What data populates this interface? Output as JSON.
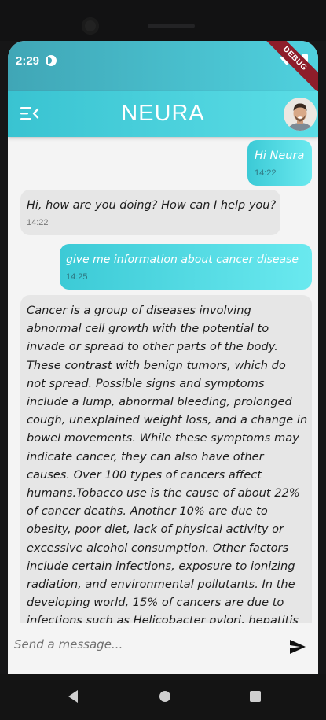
{
  "status_bar": {
    "time": "2:29",
    "debug_label": "DEBUG",
    "icons": [
      "app-notification-icon",
      "wifi-icon",
      "battery-icon"
    ]
  },
  "app_bar": {
    "title": "NEURA",
    "menu_icon": "menu-collapse-icon",
    "avatar": "user-avatar-photo"
  },
  "messages": [
    {
      "sender": "user",
      "text": "Hi Neura",
      "time": "14:22"
    },
    {
      "sender": "bot",
      "text": "Hi, how are you doing? How can I help you?",
      "time": "14:22"
    },
    {
      "sender": "user",
      "text": "give me information about cancer disease",
      "time": "14:25"
    },
    {
      "sender": "bot",
      "text": "Cancer is a group of diseases involving abnormal cell growth with the potential to invade or spread to other parts of the body. These contrast with benign tumors, which do not spread. Possible signs and symptoms include a lump, abnormal bleeding, prolonged cough, unexplained weight loss, and a change in bowel movements. While these symptoms may indicate cancer, they can also have other causes. Over 100 types of cancers affect humans.Tobacco use is the cause of about 22% of cancer deaths. Another 10% are due to obesity, poor diet, lack of physical activity or excessive alcohol consumption. Other factors include certain infections, exposure to ionizing radiation, and environmental pollutants. In the developing world, 15% of cancers are due to infections such as Helicobacter pylori, hepatitis B, hepatitis C,"
    }
  ],
  "composer": {
    "placeholder": "Send a message...",
    "send_icon": "send-icon"
  },
  "colors": {
    "accent_start": "#39c3d1",
    "accent_end": "#5bdde6",
    "bot_bubble": "#e6e6e6",
    "background": "#f4f4f4"
  }
}
